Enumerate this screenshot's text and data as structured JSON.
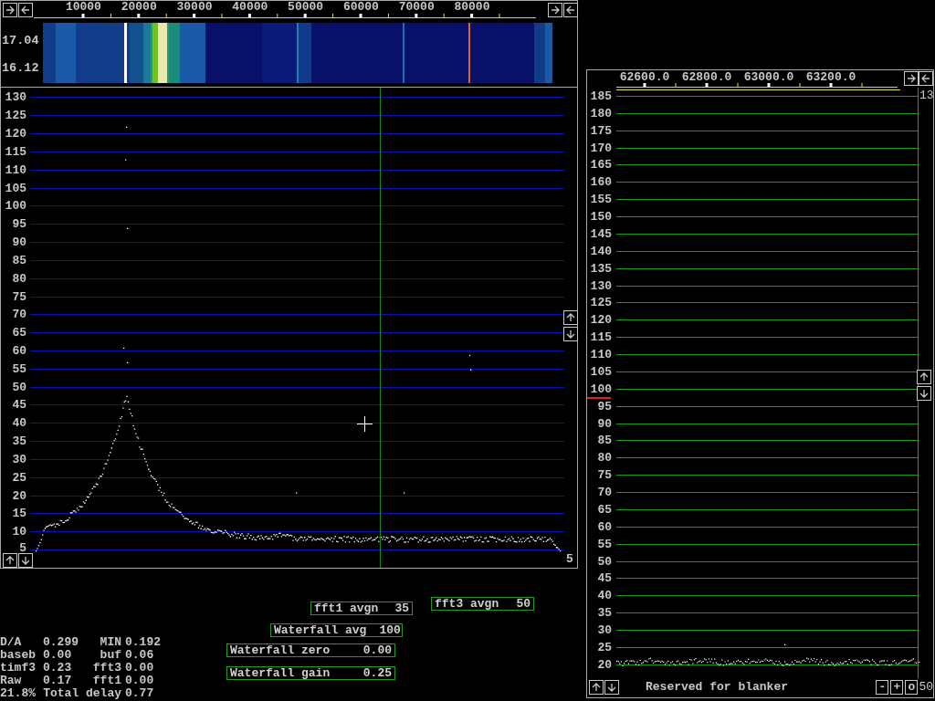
{
  "main_window": {
    "freq_axis": {
      "labels": [
        "10000",
        "20000",
        "30000",
        "40000",
        "50000",
        "60000",
        "70000",
        "80000"
      ]
    },
    "waterfall": {
      "time_labels": [
        "17.04",
        "16.12"
      ]
    },
    "spectrum": {
      "y_labels": [
        "130",
        "125",
        "120",
        "115",
        "110",
        "105",
        "100",
        "95",
        "90",
        "85",
        "80",
        "75",
        "70",
        "65",
        "60",
        "55",
        "50",
        "45",
        "40",
        "35",
        "30",
        "25",
        "20",
        "15",
        "10",
        "5"
      ],
      "scale_label": "5"
    }
  },
  "controls": [
    {
      "label": "fft1 avgn",
      "value": "35"
    },
    {
      "label": "fft3 avgn",
      "value": "50"
    },
    {
      "label": "Waterfall avg",
      "value": "100"
    },
    {
      "label": "Waterfall zero",
      "value": "0.00"
    },
    {
      "label": "Waterfall gain",
      "value": "0.25"
    }
  ],
  "stats": [
    {
      "label": "D/A",
      "value": "0.299",
      "label2": "MIN",
      "value2": "0.192"
    },
    {
      "label": "baseb",
      "value": "0.00",
      "label2": "buf",
      "value2": "0.06"
    },
    {
      "label": "timf3",
      "value": "0.23",
      "label2": "fft3",
      "value2": "0.00"
    },
    {
      "label": "Raw",
      "value": "0.17",
      "label2": "fft1",
      "value2": "0.00"
    },
    {
      "label": "21.8%",
      "label2": "Total delay",
      "value2": "0.77"
    }
  ],
  "baseband_window": {
    "freq_labels": [
      "62600.0",
      "62800.0",
      "63000.0",
      "63200.0"
    ],
    "corner_label": "13",
    "y_labels": [
      "185",
      "180",
      "175",
      "170",
      "165",
      "160",
      "155",
      "150",
      "145",
      "140",
      "135",
      "130",
      "125",
      "120",
      "115",
      "110",
      "105",
      "100",
      "95",
      "90",
      "85",
      "80",
      "75",
      "70",
      "65",
      "60",
      "55",
      "50",
      "45",
      "40",
      "35",
      "30",
      "25",
      "20"
    ],
    "bottom_label": "Reserved for blanker",
    "buttons": [
      "-",
      "+",
      "o"
    ],
    "bottom_value": "50"
  }
}
